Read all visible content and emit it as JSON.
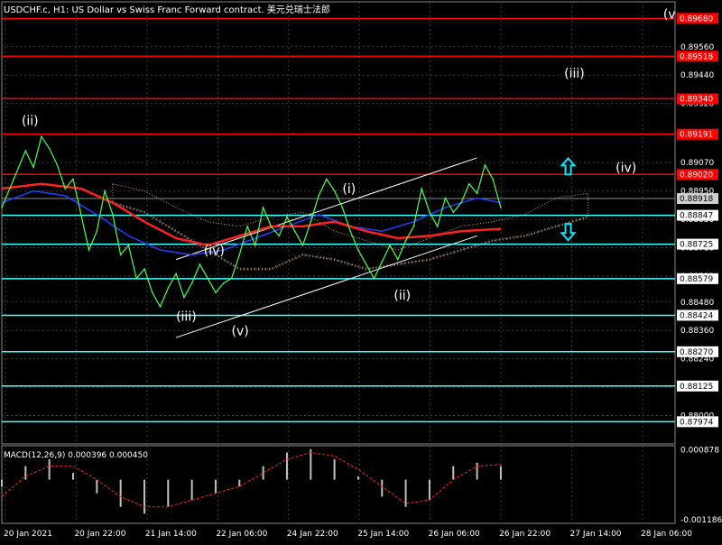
{
  "header": {
    "title": "USDCHF.c, H1: US Dollar vs Swiss Franc Forward contract. 美元兑瑞士法郎"
  },
  "colors": {
    "background": "#000000",
    "grid": "#3a3a3a",
    "price_line": "#4cff4c",
    "ma_red": "#ff2020",
    "ma_blue": "#2040ff",
    "cloud": "#c8a080",
    "level_red": "#ff0000",
    "level_cyan": "#40ffff",
    "channel": "#ffffff",
    "arrow": "#00e5ff",
    "macd_hist": "#c0c0c0",
    "macd_signal": "#ff2020"
  },
  "icons": {
    "up_arrow": "up-arrow-icon",
    "down_arrow": "down-arrow-icon"
  },
  "chart_data": {
    "type": "line",
    "title": "USDCHF.c, H1: US Dollar vs Swiss Franc Forward contract. 美元兑瑞士法郎",
    "ylim": [
      0.8788,
      0.8975
    ],
    "grid": true,
    "x_tick_labels": [
      "20 Jan 2021",
      "20 Jan 22:00",
      "21 Jan 14:00",
      "22 Jan 06:00",
      "24 Jan 22:00",
      "25 Jan 14:00",
      "26 Jan 06:00",
      "26 Jan 22:00",
      "27 Jan 14:00",
      "28 Jan 06:00"
    ],
    "y_tick_labels": [
      0.8968,
      0.8956,
      0.8944,
      0.8932,
      0.8919,
      0.8907,
      0.8895,
      0.8883,
      0.8871,
      0.8859,
      0.8848,
      0.8836,
      0.8824,
      0.8812,
      0.88
    ],
    "price_series": [
      [
        0,
        0.8888
      ],
      [
        1.5,
        0.89
      ],
      [
        3,
        0.8912
      ],
      [
        4,
        0.8905
      ],
      [
        5,
        0.8918
      ],
      [
        6,
        0.8913
      ],
      [
        7,
        0.8906
      ],
      [
        8,
        0.8896
      ],
      [
        9,
        0.89
      ],
      [
        10,
        0.8885
      ],
      [
        11,
        0.887
      ],
      [
        12,
        0.8878
      ],
      [
        13,
        0.8895
      ],
      [
        14,
        0.8885
      ],
      [
        15,
        0.8868
      ],
      [
        16,
        0.8872
      ],
      [
        17,
        0.8858
      ],
      [
        18,
        0.8862
      ],
      [
        19,
        0.8852
      ],
      [
        20,
        0.8846
      ],
      [
        21,
        0.8854
      ],
      [
        22,
        0.886
      ],
      [
        23,
        0.885
      ],
      [
        24,
        0.8856
      ],
      [
        25,
        0.8864
      ],
      [
        26,
        0.8858
      ],
      [
        27,
        0.8852
      ],
      [
        28,
        0.8856
      ],
      [
        29,
        0.8858
      ],
      [
        30,
        0.8868
      ],
      [
        31,
        0.888
      ],
      [
        32,
        0.8872
      ],
      [
        33,
        0.8888
      ],
      [
        34,
        0.888
      ],
      [
        35,
        0.8876
      ],
      [
        36,
        0.8884
      ],
      [
        37,
        0.8878
      ],
      [
        38,
        0.8872
      ],
      [
        39,
        0.8882
      ],
      [
        40,
        0.8893
      ],
      [
        41,
        0.89
      ],
      [
        42,
        0.8895
      ],
      [
        43,
        0.8888
      ],
      [
        44,
        0.8878
      ],
      [
        45,
        0.887
      ],
      [
        46,
        0.8864
      ],
      [
        47,
        0.8858
      ],
      [
        48,
        0.8865
      ],
      [
        49,
        0.8872
      ],
      [
        50,
        0.8866
      ],
      [
        51,
        0.8874
      ],
      [
        52,
        0.888
      ],
      [
        53,
        0.8896
      ],
      [
        54,
        0.8886
      ],
      [
        55,
        0.888
      ],
      [
        56,
        0.8892
      ],
      [
        57,
        0.8886
      ],
      [
        58,
        0.889
      ],
      [
        59,
        0.8898
      ],
      [
        60,
        0.8894
      ],
      [
        61,
        0.8906
      ],
      [
        62,
        0.89
      ],
      [
        63,
        0.8888
      ]
    ],
    "ma_red_series": [
      [
        0,
        0.8896
      ],
      [
        5,
        0.8898
      ],
      [
        10,
        0.8896
      ],
      [
        14,
        0.889
      ],
      [
        18,
        0.8882
      ],
      [
        22,
        0.8875
      ],
      [
        26,
        0.8872
      ],
      [
        30,
        0.8876
      ],
      [
        34,
        0.888
      ],
      [
        38,
        0.888
      ],
      [
        42,
        0.8882
      ],
      [
        46,
        0.8878
      ],
      [
        50,
        0.8875
      ],
      [
        54,
        0.8876
      ],
      [
        58,
        0.8878
      ],
      [
        63,
        0.8879
      ]
    ],
    "ma_blue_series": [
      [
        0,
        0.889
      ],
      [
        4,
        0.8895
      ],
      [
        8,
        0.8893
      ],
      [
        12,
        0.8885
      ],
      [
        16,
        0.8876
      ],
      [
        20,
        0.887
      ],
      [
        24,
        0.8868
      ],
      [
        28,
        0.887
      ],
      [
        32,
        0.8875
      ],
      [
        36,
        0.888
      ],
      [
        40,
        0.8885
      ],
      [
        44,
        0.888
      ],
      [
        48,
        0.8878
      ],
      [
        52,
        0.8882
      ],
      [
        56,
        0.8888
      ],
      [
        60,
        0.8892
      ],
      [
        63,
        0.889
      ]
    ],
    "cloud_upper": [
      [
        14,
        0.8898
      ],
      [
        18,
        0.8895
      ],
      [
        22,
        0.8888
      ],
      [
        26,
        0.8882
      ],
      [
        30,
        0.888
      ],
      [
        34,
        0.8884
      ],
      [
        38,
        0.8886
      ],
      [
        42,
        0.8878
      ],
      [
        46,
        0.8874
      ],
      [
        50,
        0.887
      ],
      [
        54,
        0.8875
      ],
      [
        58,
        0.888
      ],
      [
        62,
        0.8882
      ],
      [
        66,
        0.8885
      ],
      [
        70,
        0.8892
      ],
      [
        74,
        0.8894
      ]
    ],
    "cloud_lower": [
      [
        14,
        0.889
      ],
      [
        18,
        0.8886
      ],
      [
        22,
        0.8878
      ],
      [
        26,
        0.887
      ],
      [
        30,
        0.8862
      ],
      [
        34,
        0.8862
      ],
      [
        38,
        0.8868
      ],
      [
        42,
        0.8866
      ],
      [
        46,
        0.8862
      ],
      [
        50,
        0.8864
      ],
      [
        54,
        0.8866
      ],
      [
        58,
        0.887
      ],
      [
        62,
        0.8874
      ],
      [
        66,
        0.8876
      ],
      [
        70,
        0.888
      ],
      [
        74,
        0.8884
      ]
    ],
    "current_price": {
      "value": 0.88918,
      "label": "0.88918"
    },
    "levels_red": [
      {
        "value": 0.8968,
        "label": "0.89680"
      },
      {
        "value": 0.8952,
        "label": "0.89518"
      },
      {
        "value": 0.8934,
        "label": "0.89340"
      },
      {
        "value": 0.8919,
        "label": "0.89191"
      },
      {
        "value": 0.8902,
        "label": "0.89020"
      }
    ],
    "levels_cyan": [
      {
        "value": 0.88847,
        "label": "0.88847"
      },
      {
        "value": 0.88725,
        "label": "0.88725"
      },
      {
        "value": 0.88579,
        "label": "0.88579"
      },
      {
        "value": 0.88424,
        "label": "0.88424"
      },
      {
        "value": 0.8827,
        "label": "0.88270"
      },
      {
        "value": 0.88125,
        "label": "0.88125"
      },
      {
        "value": 0.87974,
        "label": "0.87974"
      }
    ],
    "channel_upper": [
      [
        22,
        0.8866
      ],
      [
        60,
        0.8909
      ]
    ],
    "channel_lower": [
      [
        22,
        0.8833
      ],
      [
        60,
        0.8876
      ]
    ],
    "wave_labels": [
      {
        "text": "(ii)",
        "x": 2.5,
        "y": 0.8923
      },
      {
        "text": "(iii)",
        "x": 22.0,
        "y": 0.884
      },
      {
        "text": "(iv)",
        "x": 25.5,
        "y": 0.8868
      },
      {
        "text": "(v)",
        "x": 29.0,
        "y": 0.8834
      },
      {
        "text": "(i)",
        "x": 43.0,
        "y": 0.8894
      },
      {
        "text": "(ii)",
        "x": 49.5,
        "y": 0.8849
      },
      {
        "text": "(iii)",
        "x": 71.0,
        "y": 0.8943
      },
      {
        "text": "(iv)",
        "x": 77.5,
        "y": 0.8903
      },
      {
        "text": "(v",
        "x": 83.5,
        "y": 0.8968
      }
    ],
    "arrows": [
      {
        "direction": "up",
        "x": 71.5,
        "y": 0.8905
      },
      {
        "direction": "down",
        "x": 71.5,
        "y": 0.8878
      }
    ],
    "macd": {
      "label": "MACD(12,26,9) 0.000396 0.000450",
      "ylim": [
        -0.001286,
        0.001
      ],
      "y_tick_labels": [
        0.000878,
        -0.001186
      ],
      "histogram": [
        [
          0,
          -0.0002
        ],
        [
          3,
          0.0004
        ],
        [
          6,
          0.0006
        ],
        [
          9,
          0.0002
        ],
        [
          12,
          -0.0004
        ],
        [
          15,
          -0.0008
        ],
        [
          18,
          -0.001
        ],
        [
          21,
          -0.0008
        ],
        [
          24,
          -0.0006
        ],
        [
          27,
          -0.0004
        ],
        [
          30,
          -0.0002
        ],
        [
          33,
          0.0004
        ],
        [
          36,
          0.0008
        ],
        [
          39,
          0.0009
        ],
        [
          42,
          0.0006
        ],
        [
          45,
          0.0001
        ],
        [
          48,
          -0.0005
        ],
        [
          51,
          -0.0008
        ],
        [
          54,
          -0.0006
        ],
        [
          57,
          0.0004
        ],
        [
          60,
          0.0005
        ],
        [
          63,
          0.0004
        ]
      ],
      "signal": [
        [
          0,
          -0.0005
        ],
        [
          3,
          0.0001
        ],
        [
          6,
          0.0004
        ],
        [
          9,
          0.0004
        ],
        [
          12,
          0.0
        ],
        [
          15,
          -0.0005
        ],
        [
          18,
          -0.0008
        ],
        [
          21,
          -0.0008
        ],
        [
          24,
          -0.0006
        ],
        [
          27,
          -0.0004
        ],
        [
          30,
          -0.0002
        ],
        [
          33,
          0.0002
        ],
        [
          36,
          0.0006
        ],
        [
          39,
          0.0008
        ],
        [
          42,
          0.0007
        ],
        [
          45,
          0.0003
        ],
        [
          48,
          -0.0002
        ],
        [
          51,
          -0.0007
        ],
        [
          54,
          -0.0006
        ],
        [
          57,
          0.0
        ],
        [
          60,
          0.0004
        ],
        [
          63,
          0.00045
        ]
      ]
    }
  }
}
